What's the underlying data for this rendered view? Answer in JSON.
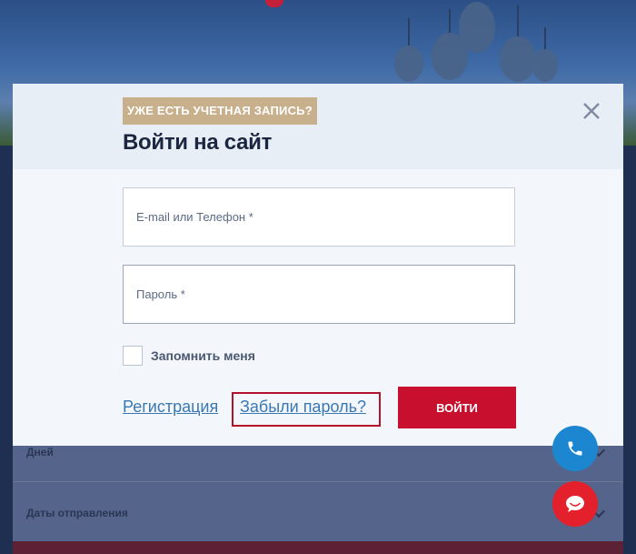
{
  "background": {
    "rows": [
      {
        "label": "Дней"
      },
      {
        "label": "Даты отправления"
      }
    ]
  },
  "modal": {
    "badge": "УЖЕ ЕСТЬ УЧЕТНАЯ ЗАПИСЬ?",
    "title": "Войти на сайт",
    "email_placeholder": "E-mail или Телефон *",
    "password_placeholder": "Пароль *",
    "remember_label": "Запомнить меня",
    "register_link": "Регистрация",
    "forgot_link": "Забыли пароль?",
    "login_button": "ВОЙТИ"
  },
  "colors": {
    "accent": "#c8102e",
    "badge": "#c9b08d",
    "link": "#3a78b4",
    "phone_fab": "#1c86d0",
    "chat_fab": "#e4202c"
  },
  "icons": {
    "close": "close-icon",
    "phone": "phone-icon",
    "chat": "chat-icon"
  }
}
